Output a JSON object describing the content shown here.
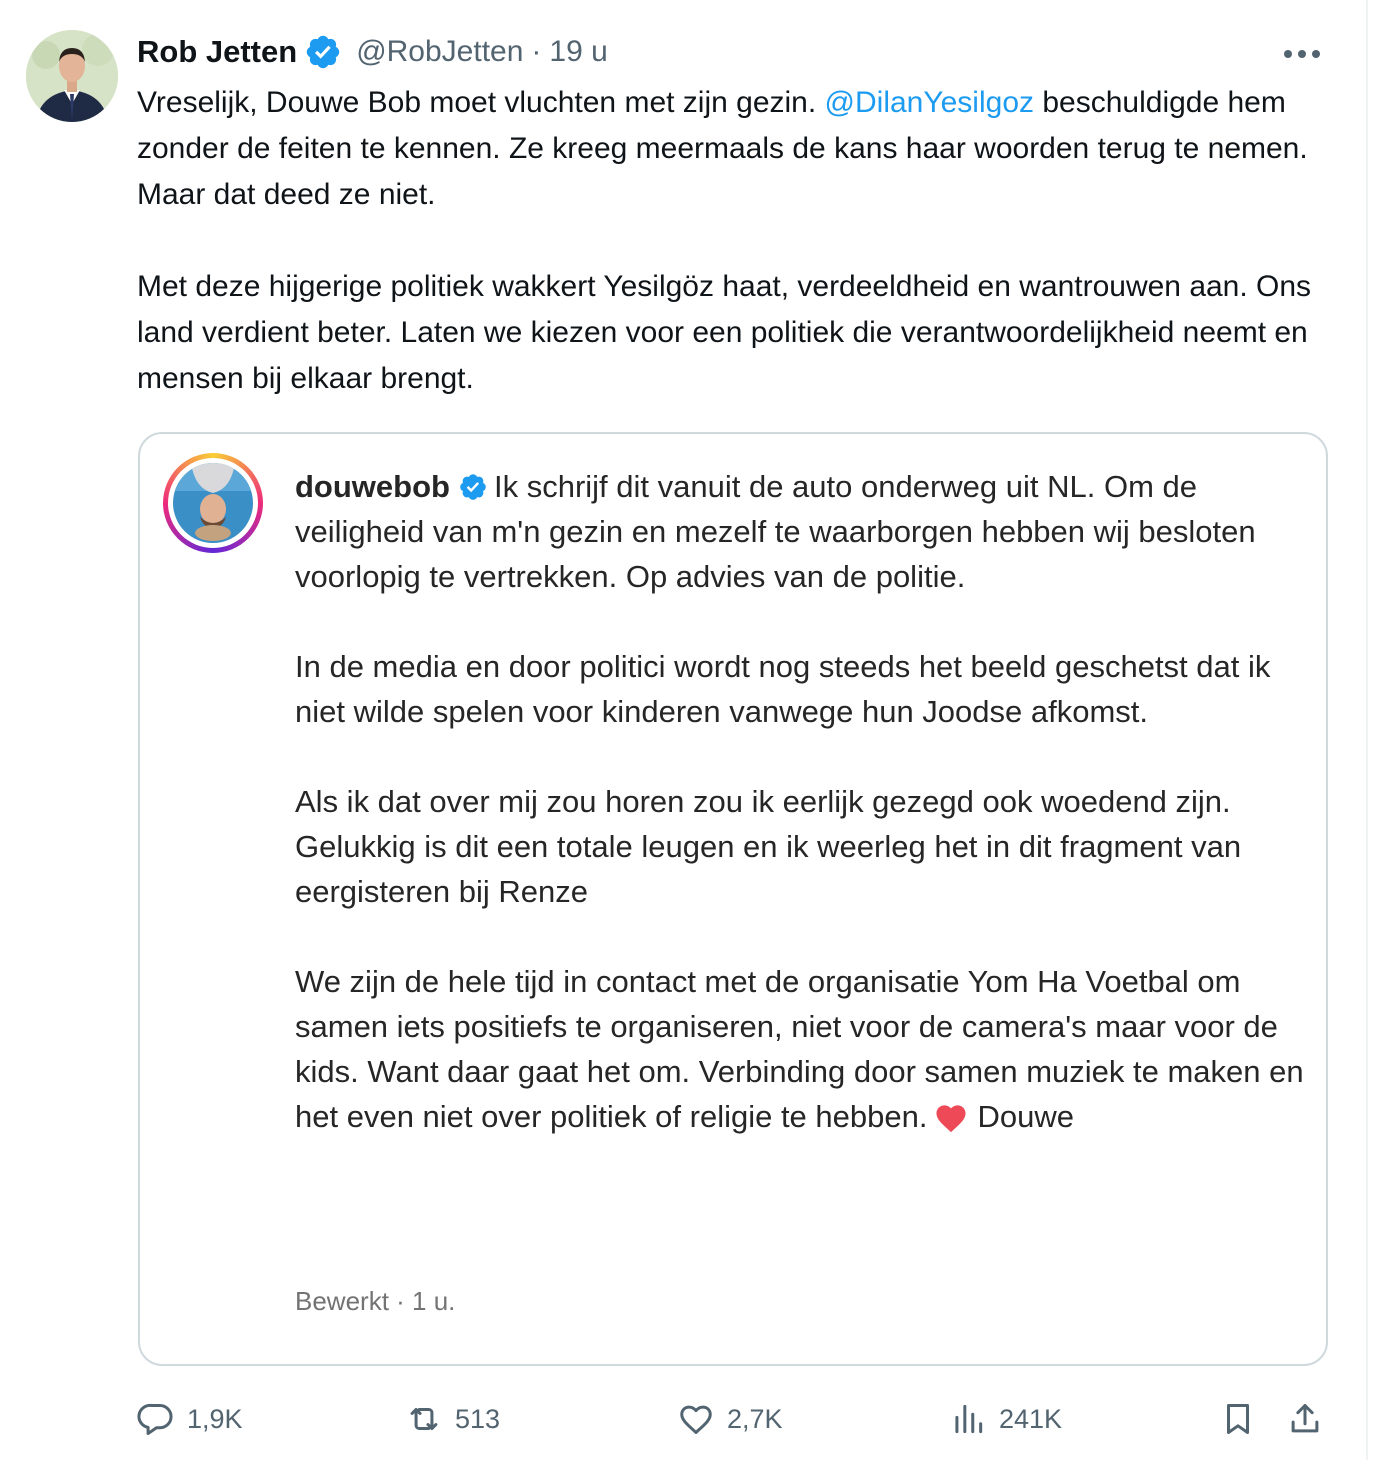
{
  "tweet": {
    "author_name": "Rob Jetten",
    "author_handle": "@RobJetten",
    "separator": "·",
    "time": "19 u",
    "text_part1": "Vreselijk, Douwe Bob moet vluchten met zijn gezin. ",
    "mention": "@DilanYesilgoz",
    "text_part2": "beschuldigde hem zonder de feiten te kennen. Ze kreeg meermaals de kans haar woorden terug te nemen. Maar dat deed ze niet.",
    "text_para2": "Met deze hijgerige politiek wakkert Yesilgöz haat, verdeeldheid en wantrouwen aan. Ons land verdient beter. Laten we kiezen voor een politiek die verantwoordelijkheid neemt en mensen bij elkaar brengt."
  },
  "quote": {
    "username": "douwebob",
    "para1": "Ik schrijf dit vanuit de auto onderweg uit NL. Om de veiligheid van m'n gezin en mezelf te waarborgen hebben wij besloten voorlopig te vertrekken. Op advies van de politie.",
    "para2": "In de media en door politici wordt nog steeds het beeld geschetst dat ik niet wilde spelen voor kinderen vanwege hun Joodse afkomst.",
    "para3_line1": "Als ik dat over mij zou horen zou ik eerlijk gezegd ook woedend zijn. Gelukkig is dit een totale leugen en ik weerleg het in dit fragment van",
    "para3_line2": "eergisteren bij Renze",
    "para4": "We zijn de hele tijd in contact met de organisatie Yom Ha Voetbal om samen iets positiefs te organiseren, niet voor de camera's maar voor de kids. Want daar gaat het om. Verbinding door samen muziek te maken en het even niet over politiek of religie te hebben.",
    "signoff": "Douwe",
    "edited": "Bewerkt · 1 u."
  },
  "actions": {
    "replies": "1,9K",
    "reposts": "513",
    "likes": "2,7K",
    "views": "241K"
  },
  "colors": {
    "link": "#1d9bf0",
    "verified": "#1d9bf0",
    "secondary_text": "#536471",
    "heart": "#ed4956"
  },
  "icons": [
    "verified-badge-icon",
    "more-icon",
    "reply-icon",
    "repost-icon",
    "like-icon",
    "views-icon",
    "bookmark-icon",
    "share-icon",
    "heart-emoji-icon"
  ]
}
